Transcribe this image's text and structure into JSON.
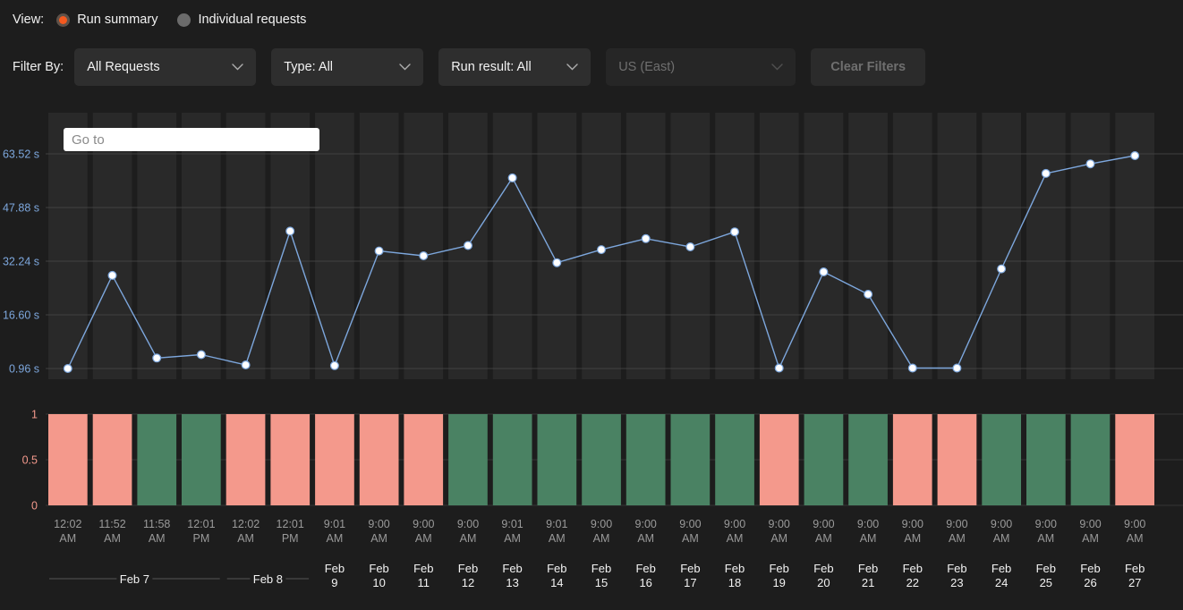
{
  "view": {
    "label": "View:",
    "options": [
      {
        "label": "Run summary",
        "selected": true
      },
      {
        "label": "Individual requests",
        "selected": false
      }
    ]
  },
  "filters": {
    "label": "Filter By:",
    "dropdowns": [
      {
        "name": "requests",
        "value": "All Requests",
        "disabled": false
      },
      {
        "name": "type",
        "value": "Type: All",
        "disabled": false
      },
      {
        "name": "run-result",
        "value": "Run result: All",
        "disabled": false
      },
      {
        "name": "region",
        "value": "US (East)",
        "disabled": true
      }
    ],
    "clear_label": "Clear Filters",
    "clear_disabled": true
  },
  "goto": {
    "placeholder": "Go to",
    "value": ""
  },
  "colors": {
    "accent_orange": "#f4591f",
    "line_blue": "#7da7dd",
    "point_white": "#ffffff",
    "bar_fail": "#f4998c",
    "bar_pass": "#4a8263",
    "axis_blue": "#7da7dd",
    "background": "#1d1d1d",
    "column_band": "#333333"
  },
  "chart_data": [
    {
      "type": "line",
      "title": "",
      "xlabel": "",
      "ylabel": "",
      "ylim": [
        0.96,
        63.52
      ],
      "grid": true,
      "ytick_labels": [
        "0.96 s",
        "16.60 s",
        "32.24 s",
        "47.88 s",
        "63.52 s"
      ],
      "ytick_values": [
        0.96,
        16.6,
        32.24,
        47.88,
        63.52
      ],
      "x": [
        "12:02 AM Feb 7",
        "11:52 AM Feb 7",
        "11:58 AM Feb 7",
        "12:01 PM Feb 7",
        "12:02 AM Feb 8",
        "12:01 PM Feb 8",
        "9:01 AM Feb 9",
        "9:00 AM Feb 10",
        "9:00 AM Feb 11",
        "9:00 AM Feb 12",
        "9:01 AM Feb 13",
        "9:01 AM Feb 14",
        "9:00 AM Feb 15",
        "9:00 AM Feb 16",
        "9:00 AM Feb 17",
        "9:00 AM Feb 18",
        "9:00 AM Feb 19",
        "9:00 AM Feb 20",
        "9:00 AM Feb 21",
        "9:00 AM Feb 22",
        "9:00 AM Feb 23",
        "9:00 AM Feb 24",
        "9:00 AM Feb 25",
        "9:00 AM Feb 26",
        "9:00 AM Feb 27"
      ],
      "values": [
        0.96,
        28.1,
        4.0,
        5.0,
        2.0,
        41.0,
        1.8,
        35.2,
        33.8,
        36.8,
        56.5,
        31.8,
        35.6,
        38.8,
        36.4,
        40.8,
        1.1,
        29.1,
        22.6,
        1.1,
        1.1,
        30.0,
        57.8,
        60.6,
        63.0
      ]
    },
    {
      "type": "bar",
      "title": "",
      "xlabel": "",
      "ylabel": "",
      "ylim": [
        0,
        1
      ],
      "ytick_labels": [
        "0",
        "0.5",
        "1"
      ],
      "ytick_values": [
        0,
        0.5,
        1
      ],
      "categories": [
        "12:02 AM Feb 7",
        "11:52 AM Feb 7",
        "11:58 AM Feb 7",
        "12:01 PM Feb 7",
        "12:02 AM Feb 8",
        "12:01 PM Feb 8",
        "9:01 AM Feb 9",
        "9:00 AM Feb 10",
        "9:00 AM Feb 11",
        "9:00 AM Feb 12",
        "9:01 AM Feb 13",
        "9:01 AM Feb 14",
        "9:00 AM Feb 15",
        "9:00 AM Feb 16",
        "9:00 AM Feb 17",
        "9:00 AM Feb 18",
        "9:00 AM Feb 19",
        "9:00 AM Feb 20",
        "9:00 AM Feb 21",
        "9:00 AM Feb 22",
        "9:00 AM Feb 23",
        "9:00 AM Feb 24",
        "9:00 AM Feb 25",
        "9:00 AM Feb 26",
        "9:00 AM Feb 27"
      ],
      "values": [
        1,
        1,
        1,
        1,
        1,
        1,
        1,
        1,
        1,
        1,
        1,
        1,
        1,
        1,
        1,
        1,
        1,
        1,
        1,
        1,
        1,
        1,
        1,
        1,
        1
      ],
      "result": [
        "fail",
        "fail",
        "pass",
        "pass",
        "fail",
        "fail",
        "fail",
        "fail",
        "fail",
        "pass",
        "pass",
        "pass",
        "pass",
        "pass",
        "pass",
        "pass",
        "fail",
        "pass",
        "pass",
        "fail",
        "fail",
        "pass",
        "pass",
        "pass",
        "fail"
      ]
    }
  ],
  "xaxis": {
    "times": [
      "12:02 AM",
      "11:52 AM",
      "11:58 AM",
      "12:01 PM",
      "12:02 AM",
      "12:01 PM",
      "9:01 AM",
      "9:00 AM",
      "9:00 AM",
      "9:00 AM",
      "9:01 AM",
      "9:01 AM",
      "9:00 AM",
      "9:00 AM",
      "9:00 AM",
      "9:00 AM",
      "9:00 AM",
      "9:00 AM",
      "9:00 AM",
      "9:00 AM",
      "9:00 AM",
      "9:00 AM",
      "9:00 AM",
      "9:00 AM",
      "9:00 AM"
    ],
    "date_groups": [
      {
        "label": "Feb 7",
        "start": 0,
        "count": 4
      },
      {
        "label": "Feb 8",
        "start": 4,
        "count": 2
      },
      {
        "label": "Feb 9",
        "start": 6,
        "count": 1
      },
      {
        "label": "Feb 10",
        "start": 7,
        "count": 1
      },
      {
        "label": "Feb 11",
        "start": 8,
        "count": 1
      },
      {
        "label": "Feb 12",
        "start": 9,
        "count": 1
      },
      {
        "label": "Feb 13",
        "start": 10,
        "count": 1
      },
      {
        "label": "Feb 14",
        "start": 11,
        "count": 1
      },
      {
        "label": "Feb 15",
        "start": 12,
        "count": 1
      },
      {
        "label": "Feb 16",
        "start": 13,
        "count": 1
      },
      {
        "label": "Feb 17",
        "start": 14,
        "count": 1
      },
      {
        "label": "Feb 18",
        "start": 15,
        "count": 1
      },
      {
        "label": "Feb 19",
        "start": 16,
        "count": 1
      },
      {
        "label": "Feb 20",
        "start": 17,
        "count": 1
      },
      {
        "label": "Feb 21",
        "start": 18,
        "count": 1
      },
      {
        "label": "Feb 22",
        "start": 19,
        "count": 1
      },
      {
        "label": "Feb 23",
        "start": 20,
        "count": 1
      },
      {
        "label": "Feb 24",
        "start": 21,
        "count": 1
      },
      {
        "label": "Feb 25",
        "start": 22,
        "count": 1
      },
      {
        "label": "Feb 26",
        "start": 23,
        "count": 1
      },
      {
        "label": "Feb 27",
        "start": 24,
        "count": 1
      }
    ]
  }
}
